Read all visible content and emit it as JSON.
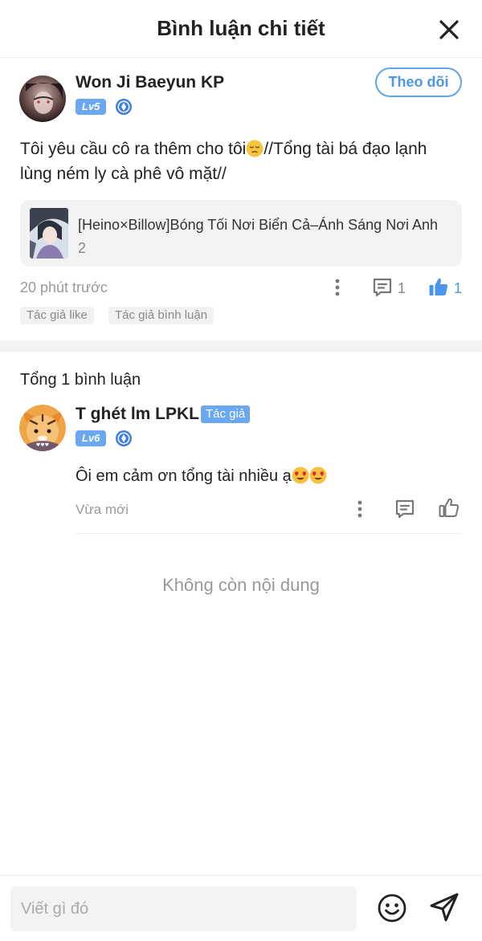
{
  "header": {
    "title": "Bình luận chi tiết",
    "close_icon": "close-icon"
  },
  "post": {
    "username": "Won Ji Baeyun KP",
    "level": "Lv5",
    "follow_label": "Theo dõi",
    "text_part1": "Tôi yêu cầu cô ra thêm cho tôi",
    "text_emoji": "pensive-face-emoji",
    "text_part2": "//Tổng tài bá đạo lạnh lùng ném ly cà phê vô mặt//",
    "story": {
      "title": "[Heino×Billow]Bóng Tối Nơi Biển Cả–Ánh Sáng Nơi Anh",
      "chapter": "2"
    },
    "time": "20 phút trước",
    "comment_count": "1",
    "like_count": "1",
    "tags": [
      "Tác giả like",
      "Tác giả bình luận"
    ]
  },
  "comments": {
    "total_label": "Tổng 1 bình luận"
  },
  "reply": {
    "username": "T ghét lm LPKL",
    "author_badge": "Tác giả",
    "level": "Lv6",
    "text": "Ôi em cảm ơn tổng tài nhiều ạ",
    "text_emoji": "heart-eyes-emoji",
    "time": "Vừa mới"
  },
  "empty_label": "Không còn nội dung",
  "composer": {
    "placeholder": "Viết gì đó"
  },
  "colors": {
    "accent": "#4a96ea",
    "badge": "#6aa8ef",
    "muted": "#999999"
  }
}
